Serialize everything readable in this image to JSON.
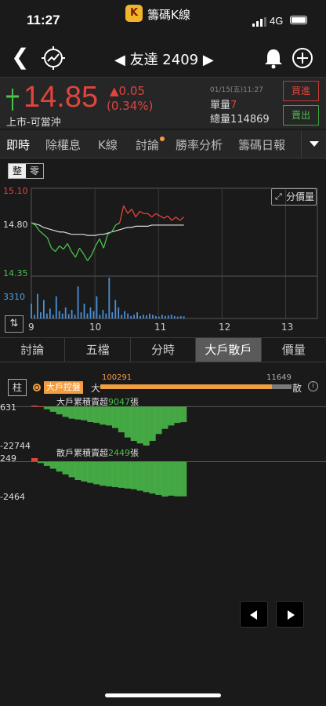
{
  "status": {
    "time": "11:27",
    "app_badge": "K",
    "app_name": "籌碼K線",
    "network": "4G"
  },
  "nav": {
    "title": "◀ 友達 2409 ▶"
  },
  "quote": {
    "price": "14.85",
    "change": "▲0.05",
    "change_pct": "(0.34%)",
    "market": "上市-可當沖",
    "timestamp": "01/15(五)11:27",
    "single_label": "單量",
    "single_value": "7",
    "total_label": "總量",
    "total_value": "114869",
    "buy_label": "買進",
    "sell_label": "賣出"
  },
  "main_tabs": [
    "即時",
    "除權息",
    "K線",
    "討論",
    "勝率分析",
    "籌碼日報"
  ],
  "toggle": {
    "on": "整",
    "off": "零"
  },
  "distribution_label": "分價量",
  "swap_label": "⇅",
  "chart_data": [
    {
      "type": "line",
      "title": "",
      "y_labels": {
        "high": "15.10",
        "ref": "14.80",
        "low": "14.35",
        "volume": "3310"
      },
      "ylim": [
        14.35,
        15.1
      ],
      "x_ticks": [
        "9",
        "10",
        "11",
        "12",
        "13"
      ],
      "x_range_hours": [
        9,
        13.5
      ],
      "series": [
        {
          "values": [
            14.8,
            14.78,
            14.73,
            14.7,
            14.67,
            14.58,
            14.55,
            14.6,
            14.57,
            14.62,
            14.55,
            14.5,
            14.58,
            14.53,
            14.47,
            14.52,
            14.6,
            14.66,
            14.58,
            14.7,
            14.72,
            14.78,
            14.8,
            14.95,
            14.88,
            14.92,
            14.85,
            14.9,
            14.88,
            14.88,
            14.85,
            14.88,
            14.86,
            14.84,
            14.86,
            14.82,
            14.85,
            14.82,
            14.85
          ]
        },
        {
          "values": [
            14.8,
            14.79,
            14.78,
            14.76,
            14.75,
            14.74,
            14.73,
            14.72,
            14.72,
            14.71,
            14.7,
            14.7,
            14.7,
            14.7,
            14.69,
            14.69,
            14.69,
            14.7,
            14.7,
            14.71,
            14.72,
            14.73,
            14.74,
            14.75,
            14.76,
            14.76,
            14.77,
            14.77,
            14.77,
            14.77,
            14.78,
            14.78,
            14.78,
            14.78,
            14.78,
            14.78,
            14.78,
            14.78,
            14.78
          ]
        }
      ],
      "volume_values": [
        1200,
        300,
        2000,
        500,
        1500,
        400,
        800,
        300,
        1800,
        600,
        400,
        900,
        350,
        700,
        300,
        2600,
        500,
        1200,
        400,
        900,
        600,
        1800,
        300,
        700,
        400,
        3310,
        500,
        1500,
        900,
        300,
        600,
        400,
        200,
        300,
        500,
        200,
        300,
        250,
        400,
        300,
        200,
        150,
        300,
        200,
        250,
        300,
        200,
        150,
        200,
        180
      ]
    },
    {
      "type": "area",
      "title": "大戶散戶",
      "big_label": "大戶累積賣超",
      "big_value": "9047",
      "small_label": "散戶累積賣超",
      "small_value": "2449",
      "unit": "張",
      "big_axis": [
        "631",
        "-22744"
      ],
      "small_axis": [
        "249",
        "-2464"
      ],
      "big_series": [
        631,
        200,
        -1500,
        -3000,
        -4500,
        -6000,
        -7000,
        -7500,
        -8000,
        -9000,
        -9500,
        -10500,
        -11000,
        -12500,
        -15000,
        -18000,
        -20000,
        -21500,
        -22744,
        -20000,
        -16000,
        -13000,
        -11000,
        -9500,
        -9047
      ],
      "small_series": [
        249,
        -100,
        -300,
        -500,
        -700,
        -900,
        -1100,
        -1300,
        -1400,
        -1500,
        -1600,
        -1700,
        -1750,
        -1800,
        -1850,
        -1900,
        -1950,
        -2050,
        -2150,
        -2250,
        -2350,
        -2464,
        -2400,
        -2450,
        -2449
      ]
    }
  ],
  "sub_tabs": [
    "討論",
    "五檔",
    "分時",
    "大戶散戶",
    "價量"
  ],
  "bigsmall": {
    "pillar_label": "柱",
    "control_label": "大戶控盤",
    "big_label": "大",
    "big_count": "100291",
    "small_count": "11649",
    "small_label": "散",
    "big_ratio": 0.896
  },
  "colors": {
    "up": "#e0443c",
    "down": "#4cc14c",
    "accent": "#f39c40",
    "avg": "#dddddd",
    "volume": "#4a90d9"
  }
}
